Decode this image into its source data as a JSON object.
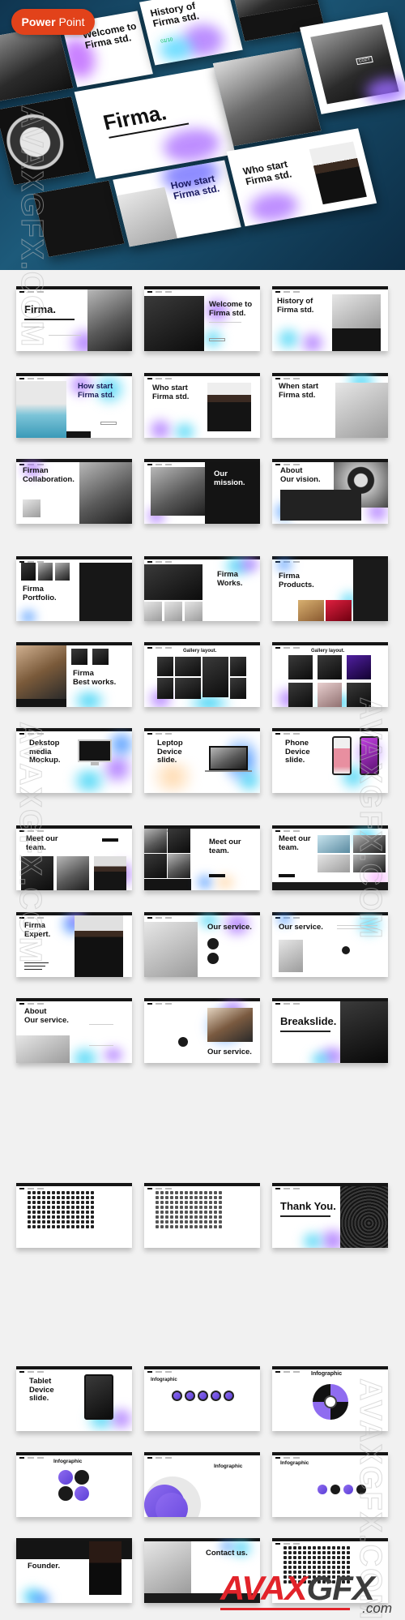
{
  "badge": {
    "bold": "Power",
    "light": "Point",
    "color": "#e2421a"
  },
  "hero": {
    "cards": [
      {
        "title": "Welcome to\nFirma std."
      },
      {
        "title": "History of\nFirma std.",
        "counter": "01/10"
      },
      {
        "title": "Firma."
      },
      {
        "title": "How start\nFirma std."
      },
      {
        "title": "Who start\nFirma std."
      }
    ],
    "jacket_label": "COZY"
  },
  "slides": [
    {
      "title": "Firma.",
      "kind": "cover"
    },
    {
      "title": "Welcome to\nFirma std.",
      "kind": "photo-left"
    },
    {
      "title": "History of\nFirma std.",
      "kind": "history",
      "counter": "01/10"
    },
    {
      "title": "How start\nFirma std.",
      "kind": "photo-left-btn"
    },
    {
      "title": "Who start\nFirma std.",
      "kind": "portrait-right"
    },
    {
      "title": "When start\nFirma std.",
      "kind": "photo-right"
    },
    {
      "title": "Firman\nCollaboration.",
      "kind": "photo-right"
    },
    {
      "title": "Our\nmission.",
      "kind": "dark-right"
    },
    {
      "title": "About\nOur vision.",
      "kind": "vision"
    },
    {
      "title": "Firma\nPortfolio.",
      "kind": "portfolio"
    },
    {
      "title": "Firma\nWorks.",
      "kind": "works"
    },
    {
      "title": "Firma\nProducts.",
      "kind": "products"
    },
    {
      "title": "Firma\nBest works.",
      "kind": "bestworks"
    },
    {
      "title": "Gallery layout.",
      "kind": "gallery-a"
    },
    {
      "title": "Gallery layout.",
      "kind": "gallery-b"
    },
    {
      "title": "Dekstop\nmedia\nMockup.",
      "kind": "device-desktop"
    },
    {
      "title": "Leptop\nDevice\nslide.",
      "kind": "device-laptop"
    },
    {
      "title": "Phone\nDevice\nslide.",
      "kind": "device-phone"
    },
    {
      "title": "Meet our\nteam.",
      "kind": "team-a"
    },
    {
      "title": "Meet our\nteam.",
      "kind": "team-b"
    },
    {
      "title": "Meet our\nteam.",
      "kind": "team-c"
    },
    {
      "title": "Firma\nExpert.",
      "kind": "expert"
    },
    {
      "title": "Our service.",
      "kind": "service-a"
    },
    {
      "title": "Our service.",
      "kind": "service-b"
    },
    {
      "title": "About\nOur service.",
      "kind": "service-c"
    },
    {
      "title": "Our service.",
      "kind": "service-d"
    },
    {
      "title": "Breakslide.",
      "kind": "breakslide"
    },
    {
      "title": "",
      "kind": "icons-a"
    },
    {
      "title": "",
      "kind": "icons-b"
    },
    {
      "title": "Thank You.",
      "kind": "thankyou"
    },
    {
      "title": "Tablet\nDevice\nslide.",
      "kind": "device-tablet"
    },
    {
      "title": "Infographic",
      "kind": "info-a"
    },
    {
      "title": "Infographic",
      "kind": "info-b"
    },
    {
      "title": "Infographic",
      "kind": "info-c"
    },
    {
      "title": "Infographic",
      "kind": "info-d"
    },
    {
      "title": "Infographic",
      "kind": "info-e"
    },
    {
      "title": "Founder.",
      "kind": "founder"
    },
    {
      "title": "Contact us.",
      "kind": "contact"
    },
    {
      "title": "",
      "kind": "icons-c"
    }
  ],
  "watermarks": {
    "text": "AVAXGFX.COM",
    "logo_main": "AVAX",
    "logo_accent": "GFX",
    "logo_suffix": ".com"
  }
}
